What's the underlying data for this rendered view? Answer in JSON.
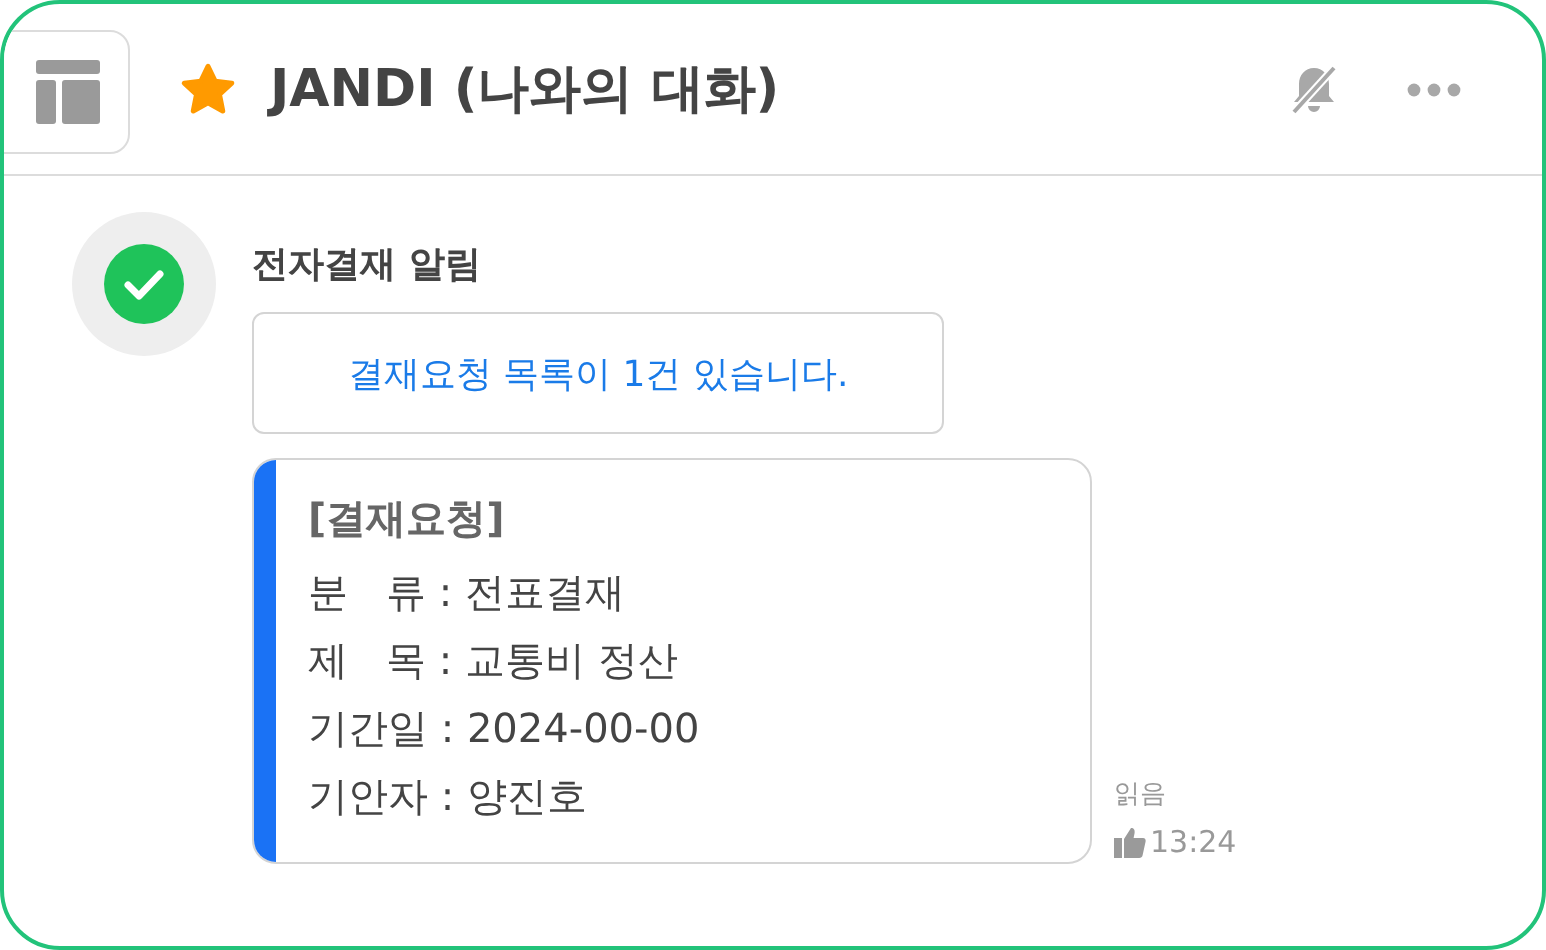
{
  "header": {
    "title": "JANDI (나와의 대화)",
    "starred": true
  },
  "message": {
    "sender": "전자결재 알림",
    "link_button": "결재요청 목록이 1건 있습니다.",
    "card": {
      "title": "[결재요청]",
      "lines": [
        "분   류 : 전표결재",
        "제   목 : 교통비 정산",
        "기간일 : 2024-00-00",
        "기안자 : 양진호"
      ]
    },
    "read_label": "읽음",
    "time": "13:24"
  }
}
